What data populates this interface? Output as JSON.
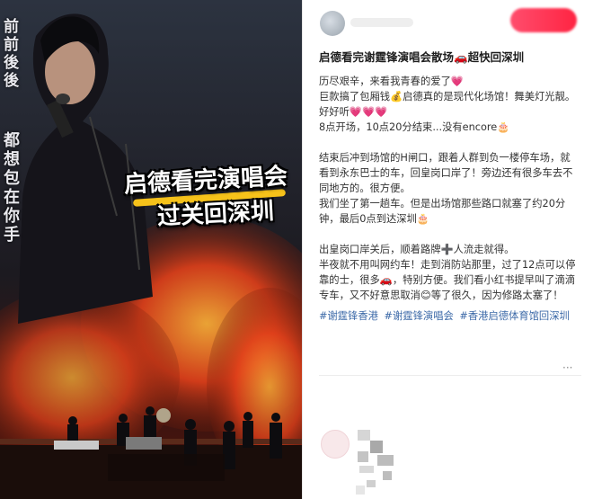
{
  "media": {
    "vertical_text_top": "前前後後",
    "vertical_text_bottom": "都想包在你手",
    "overlay_line1": "启德看完演唱会",
    "overlay_line2": "过关回深圳"
  },
  "post": {
    "title": "启德看完谢霆锋演唱会散场🚗超快回深圳",
    "paragraphs": [
      "历尽艰辛，来看我青春的爱了💗",
      "巨款搞了包厢钱💰启德真的是现代化场馆！舞美灯光靓。好好听💗💗💗",
      "8点开场，10点20分结束...没有encore🎂",
      "",
      "结束后冲到场馆的H闸口，跟着人群到负一楼停车场，就看到永东巴士的车，回皇岗口岸了！旁边还有很多车去不同地方的。很方便。",
      "我们坐了第一趟车。但是出场馆那些路口就塞了约20分钟，最后0点到达深圳🎂",
      "",
      "出皇岗口岸关后，顺着路牌➕人流走就得。",
      "半夜就不用叫网约车！走到消防站那里，过了12点可以停靠的士，很多🚗，特别方便。我们看小红书提早叫了滴滴专车，又不好意思取消😊等了很久，因为修路太塞了！"
    ],
    "tags": [
      "#谢霆锋香港",
      "#谢霆锋演唱会",
      "#香港启德体育馆回深圳"
    ],
    "edited_label": "·",
    "more_label": "···"
  }
}
